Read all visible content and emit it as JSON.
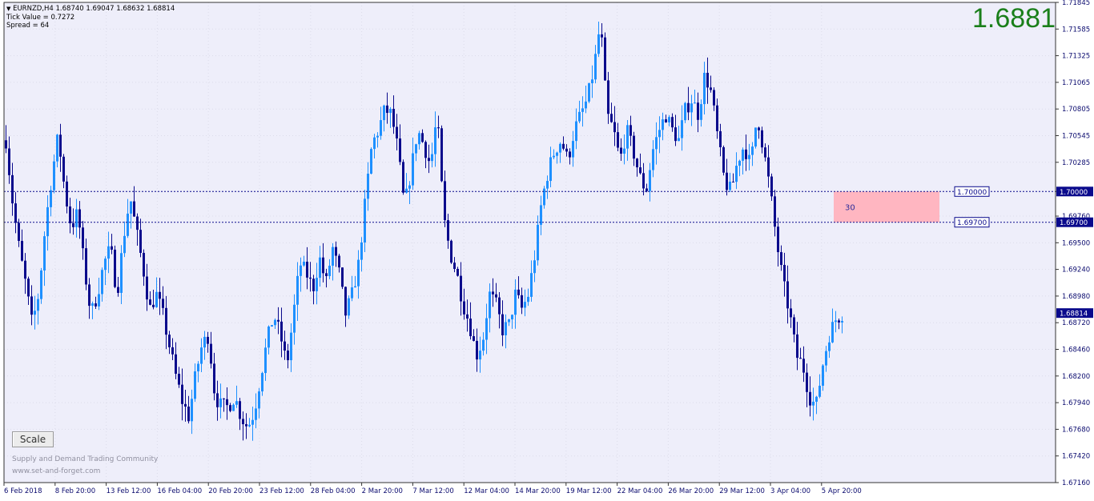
{
  "symbol_info": {
    "line1": "EURNZD,H4  1.68740 1.69047 1.68632 1.68814",
    "line2": "Tick Value = 0.7272",
    "line3": "Spread = 64"
  },
  "big_price": "1.6881",
  "scale_button": "Scale",
  "watermark": {
    "line1": "Supply and Demand Trading Community",
    "line2": "www.set-and-forget.com"
  },
  "zone": {
    "label": "30",
    "upper": 1.7,
    "lower": 1.697,
    "upper_label": "1.70000",
    "lower_label": "1.69700"
  },
  "current_price": {
    "value": 1.68814,
    "label": "1.68814"
  },
  "colors": {
    "background": "#eeeefa",
    "bull_candle": "#1e90ff",
    "bear_candle": "#0a0a8c",
    "axis_text": "#0a0a6e",
    "zone_fill": "#ffb6c1",
    "big_price": "#1a7f1a",
    "price_tag_bg": "#0a0a8c"
  },
  "chart_data": {
    "type": "candlestick",
    "symbol": "EURNZD",
    "timeframe": "H4",
    "ylim": [
      1.6716,
      1.71845
    ],
    "y_ticks": [
      "1.71845",
      "1.71585",
      "1.71325",
      "1.71065",
      "1.70805",
      "1.70545",
      "1.70285",
      "1.70000",
      "1.69760",
      "1.69500",
      "1.69240",
      "1.68980",
      "1.68720",
      "1.68460",
      "1.68200",
      "1.67940",
      "1.67680",
      "1.67420",
      "1.67160"
    ],
    "x_ticks": [
      "6 Feb 2018",
      "8 Feb 20:00",
      "13 Feb 12:00",
      "16 Feb 04:00",
      "20 Feb 20:00",
      "23 Feb 12:00",
      "28 Feb 04:00",
      "2 Mar 20:00",
      "7 Mar 12:00",
      "12 Mar 04:00",
      "14 Mar 20:00",
      "19 Mar 12:00",
      "22 Mar 04:00",
      "26 Mar 20:00",
      "29 Mar 12:00",
      "3 Apr 04:00",
      "5 Apr 20:00"
    ],
    "path": [
      1.705,
      1.699,
      1.6945,
      1.691,
      1.687,
      1.69,
      1.6965,
      1.7015,
      1.7055,
      1.7,
      1.6965,
      1.698,
      1.6925,
      1.688,
      1.69,
      1.693,
      1.6945,
      1.69,
      1.6955,
      1.6995,
      1.696,
      1.6925,
      1.6885,
      1.69,
      1.688,
      1.685,
      1.682,
      1.6795,
      1.678,
      1.682,
      1.685,
      1.686,
      1.68,
      1.679,
      1.679,
      1.68,
      1.678,
      1.677,
      1.6785,
      1.682,
      1.6855,
      1.688,
      1.686,
      1.683,
      1.688,
      1.693,
      1.692,
      1.6905,
      1.6935,
      1.691,
      1.6945,
      1.692,
      1.688,
      1.69,
      1.693,
      1.699,
      1.7045,
      1.706,
      1.708,
      1.7075,
      1.704,
      1.6985,
      1.702,
      1.706,
      1.7045,
      1.7025,
      1.7075,
      1.6975,
      1.694,
      1.692,
      1.689,
      1.687,
      1.684,
      1.6855,
      1.69,
      1.689,
      1.6865,
      1.687,
      1.69,
      1.6885,
      1.69,
      1.694,
      1.699,
      1.702,
      1.704,
      1.705,
      1.703,
      1.706,
      1.7075,
      1.709,
      1.712,
      1.7165,
      1.7075,
      1.706,
      1.703,
      1.706,
      1.704,
      1.7015,
      1.7,
      1.704,
      1.706,
      1.7075,
      1.706,
      1.705,
      1.708,
      1.709,
      1.7075,
      1.7115,
      1.7095,
      1.705,
      1.701,
      1.7,
      1.703,
      1.7045,
      1.7025,
      1.7075,
      1.704,
      1.7,
      1.695,
      1.691,
      1.688,
      1.684,
      1.683,
      1.68,
      1.679,
      1.683,
      1.686,
      1.6875,
      1.6881
    ]
  }
}
